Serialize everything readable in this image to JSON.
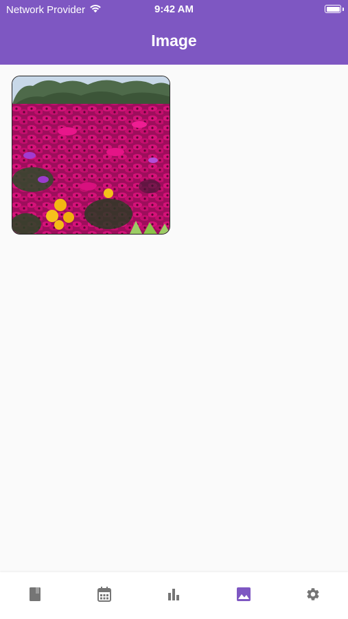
{
  "status_bar": {
    "carrier": "Network Provider",
    "time": "9:42 AM",
    "wifi_icon": "wifi-icon",
    "battery_icon": "battery-icon"
  },
  "app_bar": {
    "title": "Image",
    "color": "#7e57c2"
  },
  "gallery": {
    "items": [
      {
        "image": "flower-field-photo"
      }
    ]
  },
  "bottom_nav": {
    "items": [
      {
        "icon": "book-icon",
        "active": false
      },
      {
        "icon": "calendar-icon",
        "active": false
      },
      {
        "icon": "bar-chart-icon",
        "active": false
      },
      {
        "icon": "image-icon",
        "active": true
      },
      {
        "icon": "gear-icon",
        "active": false
      }
    ],
    "active_color": "#7e57c2",
    "inactive_color": "#757575"
  }
}
